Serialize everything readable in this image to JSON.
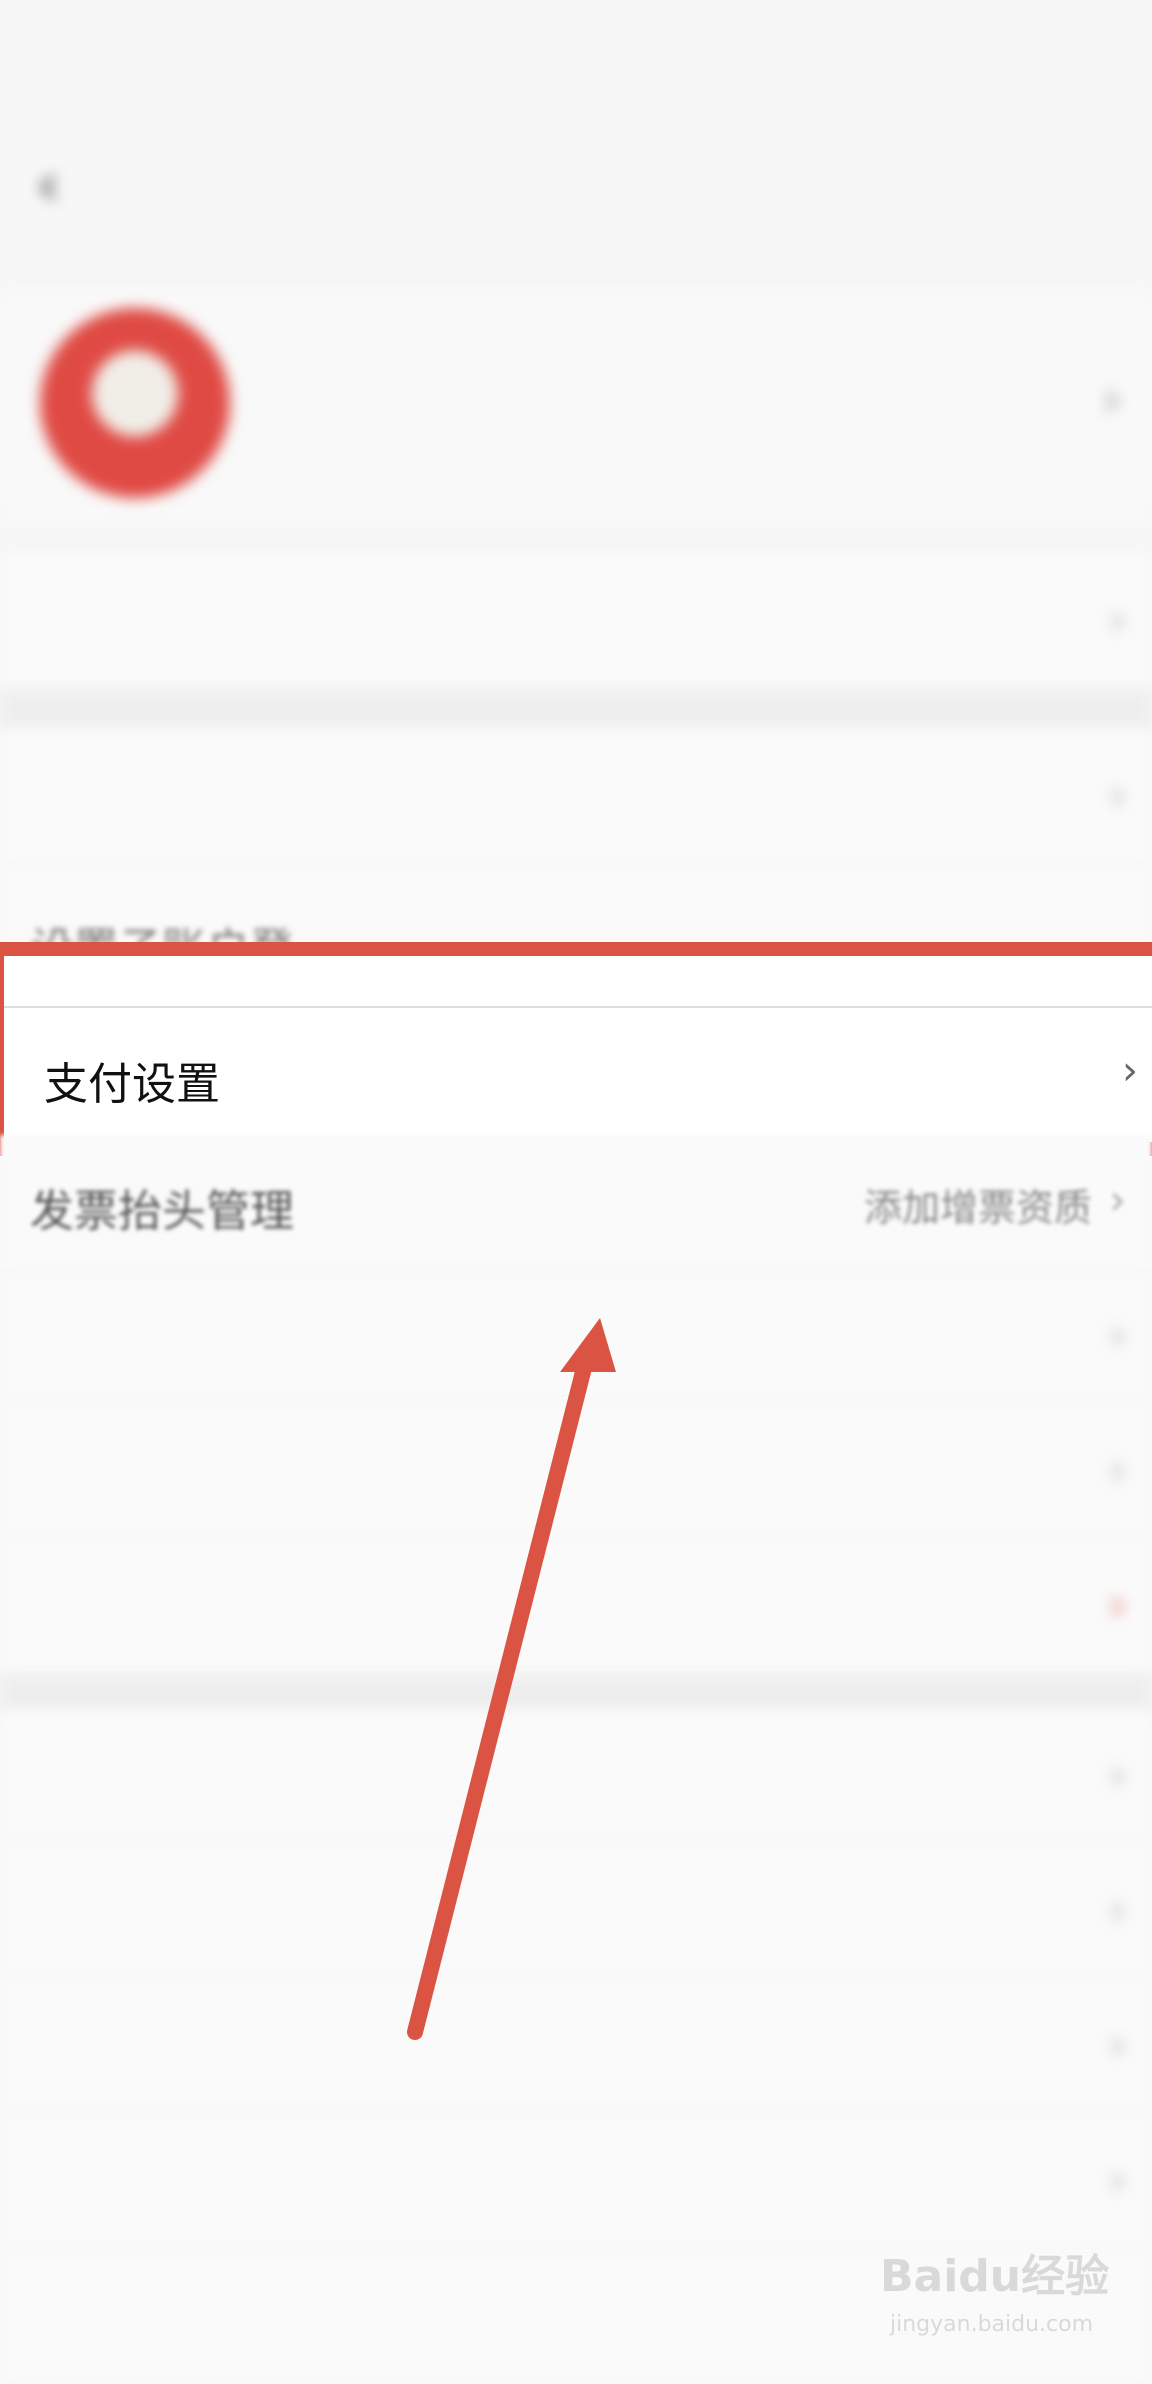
{
  "status_bar": {
    "left_text": "",
    "right_text": ""
  },
  "header": {
    "title": ""
  },
  "profile": {
    "name": "",
    "id_line": ""
  },
  "rows": {
    "address": {
      "label": ""
    },
    "account_security": {
      "label": "",
      "value": ""
    },
    "mid_partial": {
      "label": "设置子账户登"
    },
    "payment": {
      "label": "支付设置"
    },
    "invoice": {
      "label": "发票抬头管理",
      "value": "添加增票资质"
    },
    "r6": {
      "label": "",
      "value": ""
    },
    "r7": {
      "label": "",
      "value": ""
    },
    "r8": {
      "label": "",
      "value": ""
    },
    "r9": {
      "label": "",
      "value": ""
    },
    "r10": {
      "label": "",
      "value": ""
    },
    "r11": {
      "label": "",
      "value": ""
    },
    "r12": {
      "label": ""
    },
    "r13": {
      "label": ""
    }
  },
  "watermark": {
    "main": "Baidu经验",
    "sub": "jingyan.baidu.com"
  },
  "colors": {
    "highlight": "#db5343",
    "arrow": "#db5343"
  }
}
